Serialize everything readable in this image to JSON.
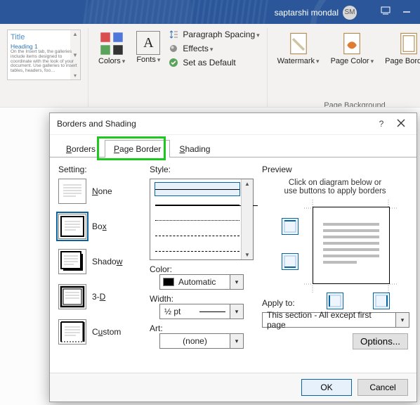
{
  "titlebar": {
    "username": "saptarshi mondal",
    "avatar_initials": "SM"
  },
  "ribbon": {
    "styles": {
      "title": "Title",
      "heading": "Heading 1"
    },
    "colors_label": "Colors",
    "fonts_label": "Fonts",
    "spacing_label": "Paragraph Spacing",
    "effects_label": "Effects",
    "default_label": "Set as Default",
    "watermark_label": "Watermark",
    "pagecolor_label": "Page Color",
    "pageborders_label": "Page Borders",
    "group_pagebg": "Page Background"
  },
  "dialog": {
    "title": "Borders and Shading",
    "tabs": {
      "borders": "Borders",
      "page_border": "Page Border",
      "shading": "Shading"
    },
    "setting": {
      "label": "Setting:",
      "none": "None",
      "box": "Box",
      "shadow": "Shadow",
      "threeD": "3-D",
      "custom": "Custom"
    },
    "style_label": "Style:",
    "color_label": "Color:",
    "color_value": "Automatic",
    "width_label": "Width:",
    "width_value": "½ pt",
    "art_label": "Art:",
    "art_value": "(none)",
    "preview": {
      "label": "Preview",
      "note1": "Click on diagram below or",
      "note2": "use buttons to apply borders"
    },
    "apply_label": "Apply to:",
    "apply_value": "This section - All except first page",
    "options_label": "Options...",
    "ok": "OK",
    "cancel": "Cancel"
  }
}
